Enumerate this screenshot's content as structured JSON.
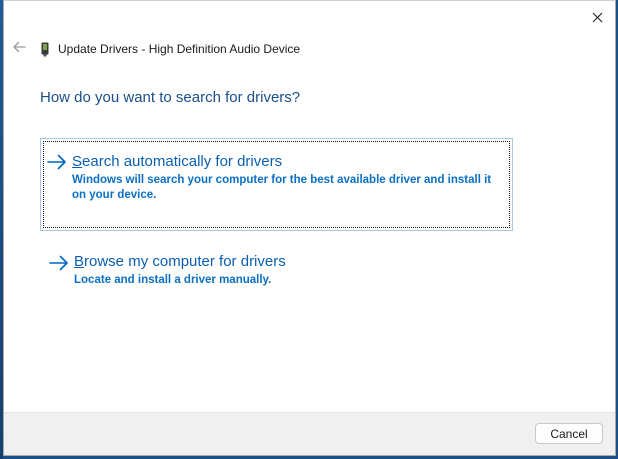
{
  "window": {
    "title": "Update Drivers - High Definition Audio Device"
  },
  "icons": {
    "close": "close-icon",
    "back": "back-arrow-icon",
    "device": "audio-device-icon",
    "option_arrow": "right-arrow-icon"
  },
  "main_instruction": "How do you want to search for drivers?",
  "options": [
    {
      "title_accel": "S",
      "title_rest": "earch automatically for drivers",
      "description": "Windows will search your computer for the best available driver and install it on your device."
    },
    {
      "title_accel": "B",
      "title_rest": "rowse my computer for drivers",
      "description": "Locate and install a driver manually."
    }
  ],
  "footer": {
    "cancel_label": "Cancel"
  },
  "colors": {
    "accent": "#0067c0",
    "instruction": "#1a4f8b",
    "option_text": "#0a5fb0",
    "footer_bg": "#f0f0f0"
  }
}
